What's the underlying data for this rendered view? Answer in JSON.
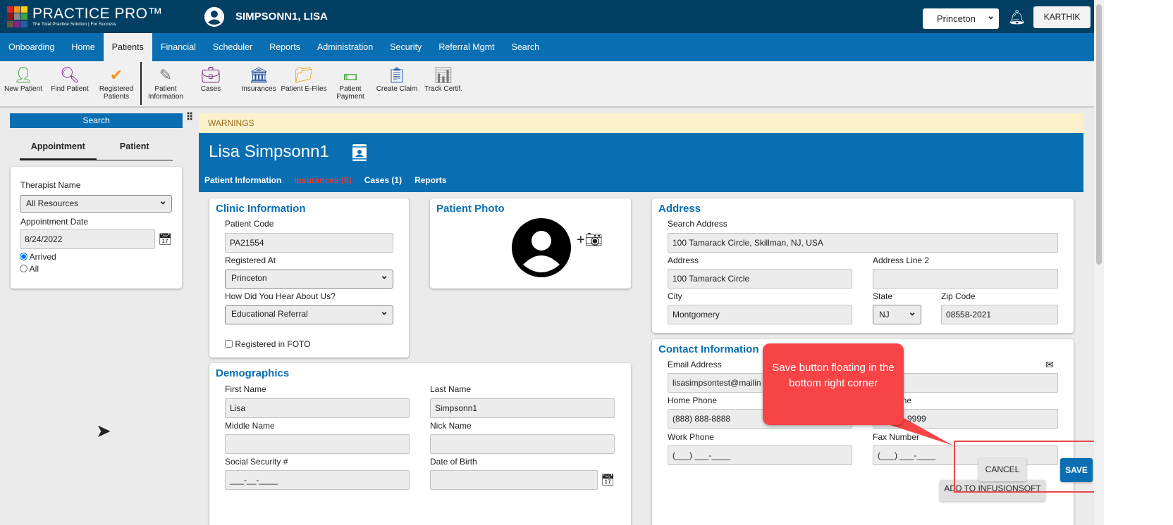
{
  "header": {
    "logo_title": "PRACTICE PRO™",
    "logo_tagline": "The Total Practice Solution | For Success",
    "logo_colors": [
      "#d6262b",
      "#f7941d",
      "#f6d20e",
      "#8b1a1a",
      "#8c8c8c",
      "#3aa63e",
      "#6b5a3a",
      "#7b2a8c",
      "#2a5bab"
    ],
    "patient_name": "SIMPSONN1, LISA",
    "location": "Princeton",
    "user": "KARTHIK"
  },
  "nav": [
    "Onboarding",
    "Home",
    "Patients",
    "Financial",
    "Scheduler",
    "Reports",
    "Administration",
    "Security",
    "Referral Mgmt",
    "Search"
  ],
  "nav_active": "Patients",
  "toolbar": [
    {
      "label": "New Patient",
      "icon": "add-person-icon",
      "color": "#3aa63e"
    },
    {
      "label": "Find Patient",
      "icon": "person-search-icon",
      "color": "#7b2a8c"
    },
    {
      "label": "Registered Patients",
      "icon": "person-check-icon",
      "color": "#f7941d"
    },
    {
      "label": "Patient Information",
      "icon": "person-edit-icon",
      "color": "#777777"
    },
    {
      "label": "Cases",
      "icon": "briefcase-icon",
      "color": "#7b2070"
    },
    {
      "label": "Insurances",
      "icon": "bank-icon",
      "color": "#1f4f9c"
    },
    {
      "label": "Patient E-Files",
      "icon": "folder-icon",
      "color": "#f7a21d"
    },
    {
      "label": "Patient Payment",
      "icon": "money-icon",
      "color": "#3aa63e"
    },
    {
      "label": "Create Claim",
      "icon": "clipboard-icon",
      "color": "#1f5aa6"
    },
    {
      "label": "Track Certif.",
      "icon": "chart-icon",
      "color": "#777777"
    }
  ],
  "left": {
    "search_label": "Search",
    "tabs": [
      "Appointment",
      "Patient"
    ],
    "therapist_label": "Therapist Name",
    "therapist_value": "All Resources",
    "date_label": "Appointment Date",
    "date_value": "8/24/2022",
    "radios": [
      {
        "label": "Arrived",
        "checked": true
      },
      {
        "label": "All",
        "checked": false
      }
    ]
  },
  "main": {
    "warnings": "WARNINGS",
    "patient_title": "Lisa Simpsonn1",
    "tabs": [
      {
        "label": "Patient Information",
        "color": "#ffffff"
      },
      {
        "label": "Insurances (0)",
        "color": "#e53935"
      },
      {
        "label": "Cases (1)",
        "color": "#ffffff"
      },
      {
        "label": "Reports",
        "color": "#ffffff"
      }
    ]
  },
  "clinic": {
    "title": "Clinic Information",
    "code_label": "Patient Code",
    "code": "PA21554",
    "registered_label": "Registered At",
    "registered": "Princeton",
    "hear_label": "How Did You Hear About Us?",
    "hear": "Educational Referral",
    "foto_label": "Registered in FOTO"
  },
  "photo": {
    "title": "Patient Photo"
  },
  "address": {
    "title": "Address",
    "search_label": "Search Address",
    "search": "100 Tamarack Circle, Skillman, NJ, USA",
    "address_label": "Address",
    "address": "100 Tamarack Circle",
    "line2_label": "Address Line 2",
    "line2": "",
    "city_label": "City",
    "city": "Montgomery",
    "state_label": "State",
    "state": "NJ",
    "zip_label": "Zip Code",
    "zip": "08558-2021"
  },
  "contact": {
    "title": "Contact Information",
    "email_label": "Email Address",
    "email": "lisasimpsontest@mailin",
    "home_label": "Home Phone",
    "home": "(888) 888-8888",
    "cell_label": "one",
    "cell": "9999",
    "work_label": "Work Phone",
    "work": "(___) ___-____",
    "fax_label": "Fax Number",
    "fax": "(___) ___-____",
    "infusion": "ADD TO INFUSIONSOFT"
  },
  "demo": {
    "title": "Demographics",
    "first_label": "First Name",
    "first": "Lisa",
    "last_label": "Last Name",
    "last": "Simpsonn1",
    "middle_label": "Middle Name",
    "nick_label": "Nick Name",
    "ssn_label": "Social Security #",
    "ssn": "___-__-____",
    "dob_label": "Date of Birth"
  },
  "actions": {
    "cancel": "CANCEL",
    "save": "SAVE"
  },
  "annotation": {
    "text": "Save button floating in the bottom right corner",
    "color": "#f84447"
  }
}
